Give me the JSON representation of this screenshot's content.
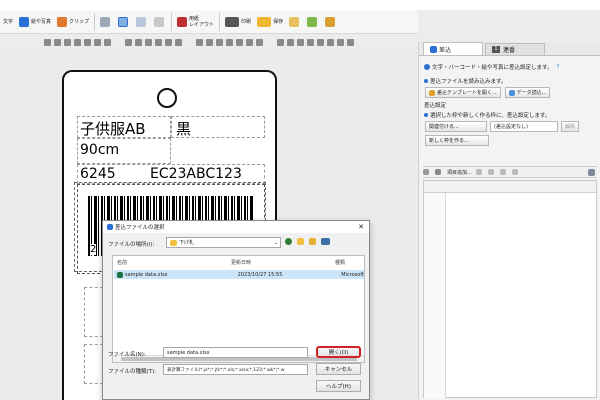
{
  "toolbar": {
    "text_label": "文字",
    "barcode_label": "絵や写真",
    "clip_label": "クリップ",
    "layout_label": "用紙\nレイアウト",
    "print_label": "印刷",
    "save_label": "保存"
  },
  "label": {
    "product": "子供服AB",
    "color": "黒",
    "size": "90cm",
    "code1": "6245",
    "code2": "EC23ABC123",
    "barcode_digit": "2"
  },
  "dialog": {
    "title": "差込ファイルの選択",
    "location_label": "ファイルの場所(I):",
    "location_value": "下げ札",
    "col_name": "名前",
    "col_date": "更新日時",
    "col_type": "種類",
    "file_name": "sample data.xlsx",
    "file_date": "2023/10/27 15:55",
    "file_type": "Microsoft",
    "filename_label": "ファイル名(N):",
    "filename_value": "sample data.xlsx",
    "filetype_label": "ファイルの種類(T):",
    "filetype_value": "表計算ファイル(*.js*;*.jfc*;*.xls;*.xlsx;*.123;*.wk*;*.w",
    "open_btn": "開く(O)",
    "cancel_btn": "キャンセル",
    "help_btn": "ヘルプ(H)"
  },
  "panel": {
    "tab1": "差込",
    "tab2": "連番",
    "tab2_num": "1",
    "info": "文字・バーコード・絵や写真に差込設定します。",
    "load_file": "差込ファイルを読み込みます。",
    "template_btn": "差込テンプレートを開く...",
    "data_btn": "データ読込...",
    "settings_header": "差込設定",
    "settings_desc": "選択した枠や新しく作る枠に、差込設定します。",
    "assoc_btn": "関連付ける...",
    "none_value": "(差込設定なし)",
    "release_btn": "解除",
    "new_frame_btn": "新しく枠を作る...",
    "add_item_btn": "項目追加...",
    "help": "?"
  },
  "colors": {
    "accent": "#2a6fd6",
    "highlight": "#d0202a",
    "selection": "#cce4f7"
  }
}
